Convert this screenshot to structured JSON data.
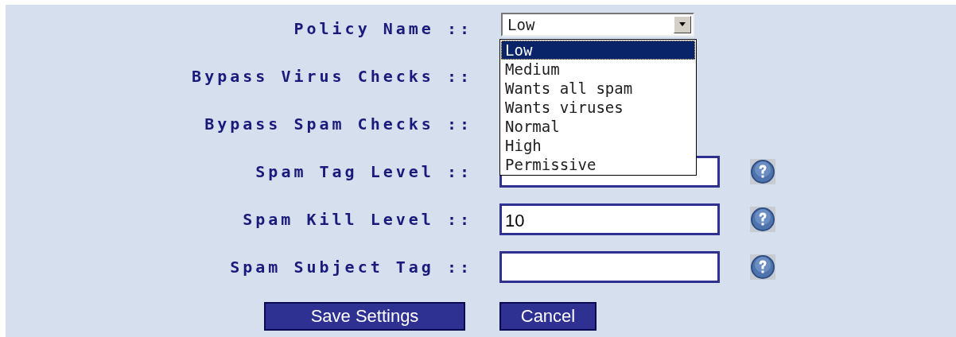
{
  "rows": [
    {
      "label": "Policy Name ::",
      "kind": "select",
      "value": "Low"
    },
    {
      "label": "Bypass Virus Checks ::",
      "kind": "none"
    },
    {
      "label": "Bypass Spam Checks ::",
      "kind": "none"
    },
    {
      "label": "Spam Tag Level ::",
      "kind": "text"
    },
    {
      "label": "Spam Kill Level ::",
      "kind": "text",
      "value": "10"
    },
    {
      "label": "Spam Subject Tag ::",
      "kind": "text"
    }
  ],
  "dropdown": {
    "options": [
      {
        "label": "Low",
        "selected": true
      },
      {
        "label": "Medium",
        "selected": false
      },
      {
        "label": "Wants all spam",
        "selected": false
      },
      {
        "label": "Wants viruses",
        "selected": false
      },
      {
        "label": "Normal",
        "selected": false
      },
      {
        "label": "High",
        "selected": false
      },
      {
        "label": "Permissive",
        "selected": false
      }
    ]
  },
  "buttons": [
    {
      "label": "Save Settings"
    },
    {
      "label": "Cancel"
    }
  ]
}
